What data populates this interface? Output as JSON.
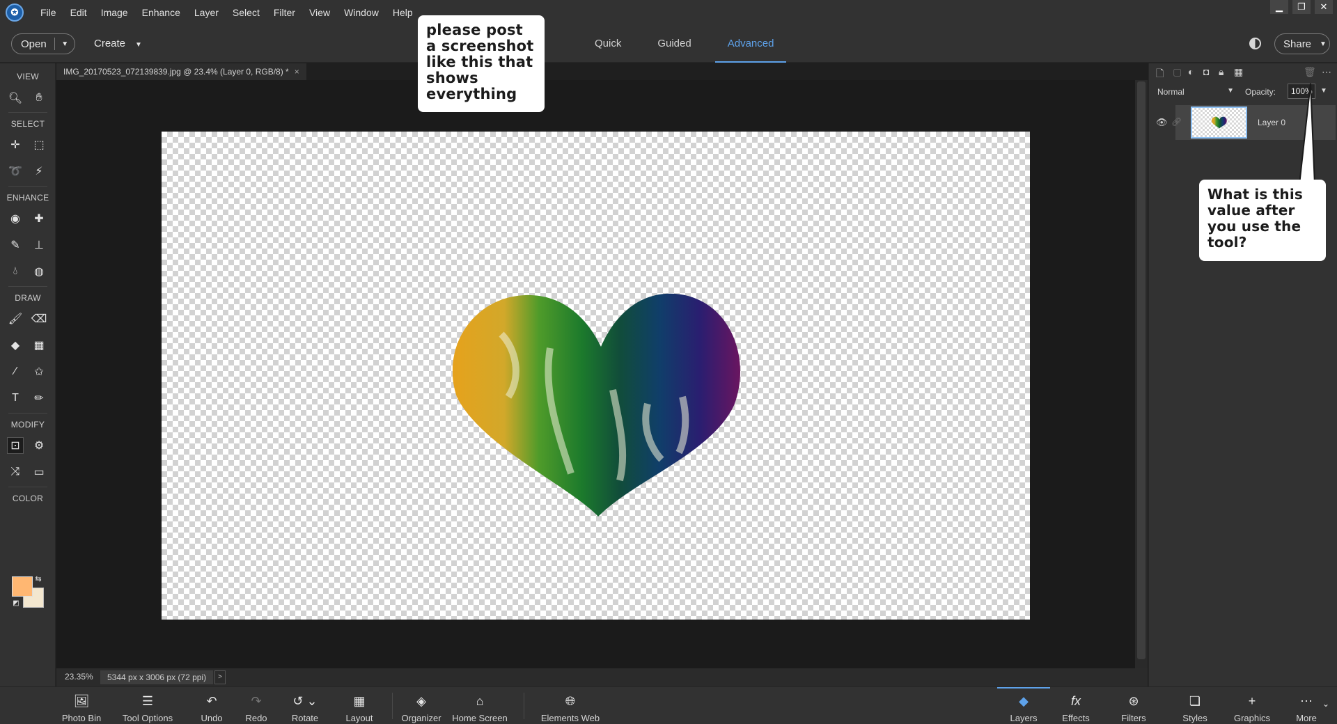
{
  "menu": {
    "app_icon": "photoshop-elements-logo",
    "items": [
      "File",
      "Edit",
      "Image",
      "Enhance",
      "Layer",
      "Select",
      "Filter",
      "View",
      "Window",
      "Help"
    ],
    "window_controls": [
      "minimize-icon",
      "restore-icon",
      "close-icon"
    ]
  },
  "toolbar": {
    "open_label": "Open",
    "create_label": "Create",
    "modes": [
      "Quick",
      "Guided",
      "Advanced"
    ],
    "active_mode": "Advanced",
    "share_label": "Share"
  },
  "tools": {
    "sections": {
      "view": "VIEW",
      "select": "SELECT",
      "enhance": "ENHANCE",
      "draw": "DRAW",
      "modify": "MODIFY",
      "color": "COLOR"
    },
    "foreground_color": "#ffb772",
    "background_color": "#f3e7cf"
  },
  "document": {
    "tab_title": "IMG_20170523_072139839.jpg @ 23.4% (Layer 0, RGB/8) *",
    "close_symbol": "×"
  },
  "status": {
    "zoom": "23.35%",
    "dimensions": "5344 px x 3006 px (72 ppi)"
  },
  "layers_panel": {
    "blend_mode": "Normal",
    "opacity_label": "Opacity:",
    "opacity_value": "100%",
    "layer_name": "Layer 0"
  },
  "bottom": {
    "left": [
      "Photo Bin",
      "Tool Options",
      "Undo",
      "Redo",
      "Rotate",
      "Layout",
      "Organizer",
      "Home Screen",
      "Elements Web"
    ],
    "right": [
      "Layers",
      "Effects",
      "Filters",
      "Styles",
      "Graphics",
      "More"
    ],
    "active": "Layers"
  },
  "callouts": {
    "c1": "please post a screenshot like this that shows everything",
    "c2": "What is this value after you use the tool?"
  },
  "colors": {
    "accent": "#5ea2ea",
    "chrome": "#323232",
    "canvas_bg": "#1b1b1b"
  }
}
